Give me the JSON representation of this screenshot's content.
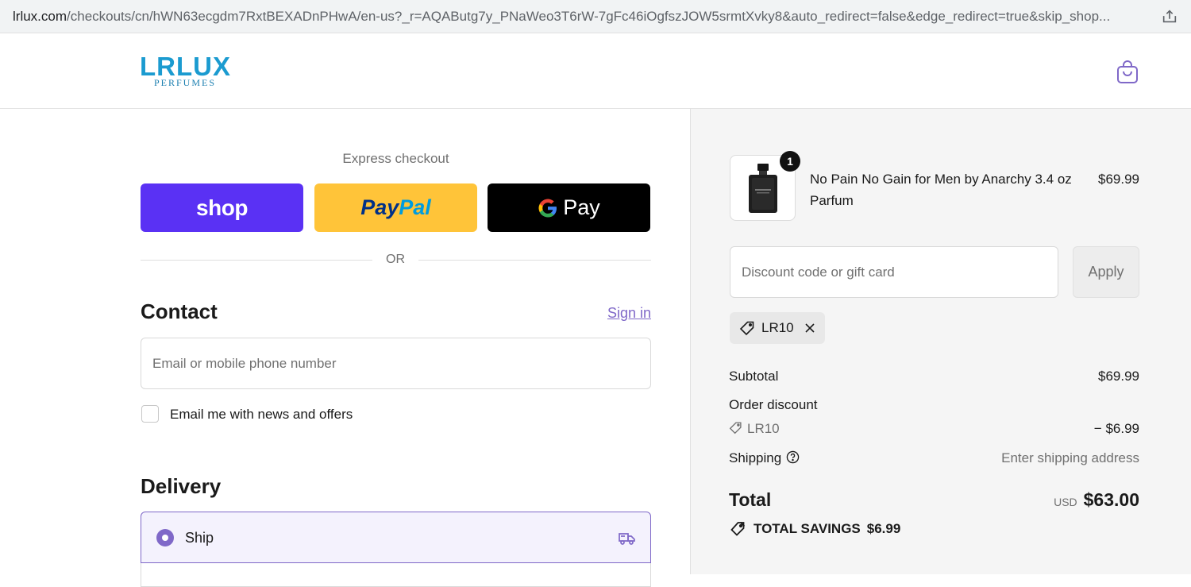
{
  "browser": {
    "url_host": "lrlux.com",
    "url_path": "/checkouts/cn/hWN63ecgdm7RxtBEXADnPHwA/en-us?_r=AQAButg7y_PNaWeo3T6rW-7gFc46iOgfszJOW5srmtXvky8&auto_redirect=false&edge_redirect=true&skip_shop..."
  },
  "header": {
    "brand": "LRLUX",
    "brand_sub": "PERFUMES"
  },
  "express": {
    "label": "Express checkout",
    "shop_label": "shop",
    "paypal_part1": "Pay",
    "paypal_part2": "Pal",
    "gpay_label": "Pay",
    "or": "OR"
  },
  "contact": {
    "title": "Contact",
    "sign_in": "Sign in",
    "email_placeholder": "Email or mobile phone number",
    "news_label": "Email me with news and offers"
  },
  "delivery": {
    "title": "Delivery",
    "ship_label": "Ship"
  },
  "cart": {
    "items": [
      {
        "name": "No Pain No Gain for Men by Anarchy 3.4 oz Parfum",
        "price": "$69.99",
        "quantity": "1"
      }
    ],
    "discount_placeholder": "Discount code or gift card",
    "apply_label": "Apply",
    "applied_code": "LR10",
    "subtotal_label": "Subtotal",
    "subtotal_value": "$69.99",
    "order_discount_label": "Order discount",
    "discount_code": "LR10",
    "discount_value": "− $6.99",
    "shipping_label": "Shipping",
    "shipping_value": "Enter shipping address",
    "total_label": "Total",
    "currency": "USD",
    "total_value": "$63.00",
    "savings_label": "TOTAL SAVINGS",
    "savings_value": "$6.99"
  },
  "colors": {
    "accent": "#7f68c8",
    "shop": "#5a31f4",
    "paypal": "#ffc439",
    "gpay": "#000000",
    "brand": "#1b9bd0"
  }
}
